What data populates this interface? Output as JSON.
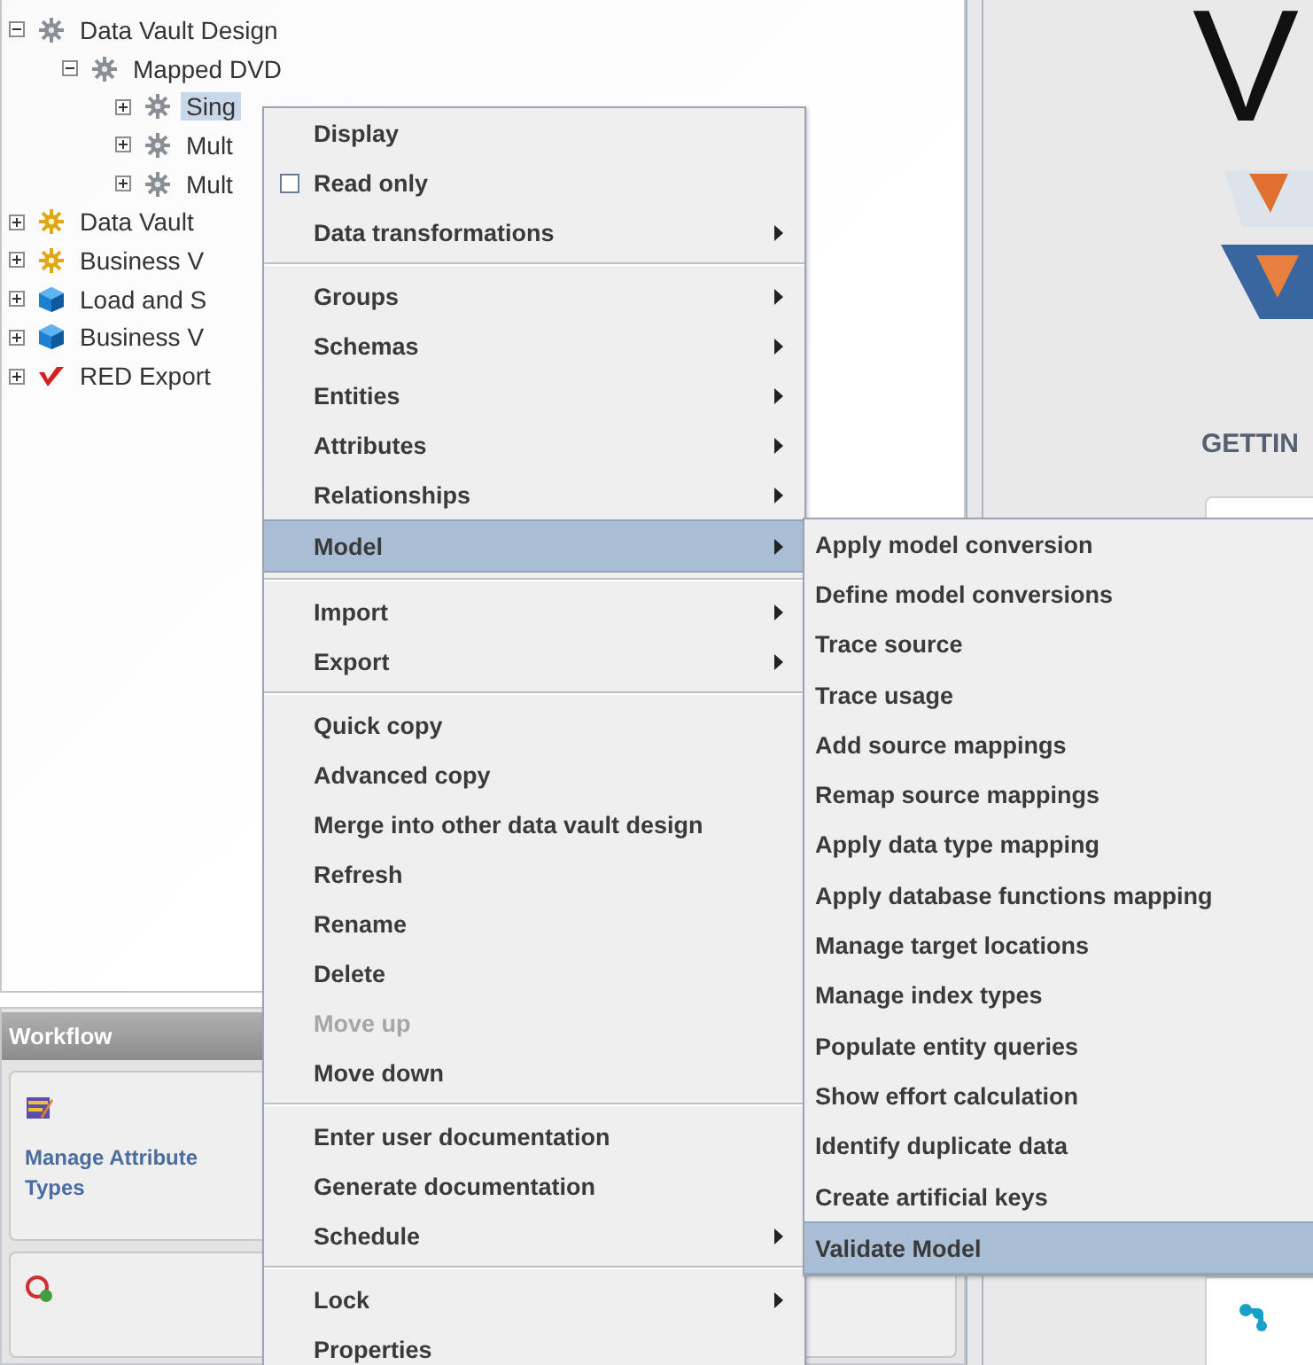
{
  "tree": [
    {
      "label": "Data Vault Design",
      "kind": "design",
      "expanded": true,
      "selected": false,
      "children": [
        {
          "label": "Mapped DVD",
          "kind": "design",
          "expanded": true,
          "selected": false,
          "children": [
            {
              "label": "Sing",
              "kind": "design",
              "expanded": false,
              "selected": true
            },
            {
              "label": "Mult",
              "kind": "design",
              "expanded": false,
              "selected": false
            },
            {
              "label": "Mult",
              "kind": "design",
              "expanded": false,
              "selected": false
            }
          ]
        }
      ]
    },
    {
      "label": "Data Vault",
      "kind": "vault",
      "expanded": false,
      "selected": false
    },
    {
      "label": "Business V",
      "kind": "vault",
      "expanded": false,
      "selected": false
    },
    {
      "label": "Load and S",
      "kind": "cube",
      "expanded": false,
      "selected": false
    },
    {
      "label": "Business V",
      "kind": "cube",
      "expanded": false,
      "selected": false
    },
    {
      "label": "RED Export",
      "kind": "export",
      "expanded": false,
      "selected": false
    }
  ],
  "workflow": {
    "title": "Workflow",
    "tasks": [
      {
        "label": "Manage Attribute Types",
        "kind": "edit"
      },
      {
        "kind": "add"
      }
    ]
  },
  "welcome": {
    "heading": "V",
    "getting_started": "GETTIN"
  },
  "context_menu": {
    "items": [
      {
        "kind": "item",
        "label": "Display",
        "selected": false,
        "disabled": false
      },
      {
        "kind": "check",
        "label": "Read only",
        "checked": false,
        "selected": false,
        "disabled": false
      },
      {
        "kind": "submenu",
        "label": "Data transformations",
        "selected": false,
        "disabled": false
      },
      {
        "kind": "separator"
      },
      {
        "kind": "submenu",
        "label": "Groups",
        "selected": false,
        "disabled": false
      },
      {
        "kind": "submenu",
        "label": "Schemas",
        "selected": false,
        "disabled": false
      },
      {
        "kind": "submenu",
        "label": "Entities",
        "selected": false,
        "disabled": false
      },
      {
        "kind": "submenu",
        "label": "Attributes",
        "selected": false,
        "disabled": false
      },
      {
        "kind": "submenu",
        "label": "Relationships",
        "selected": false,
        "disabled": false
      },
      {
        "kind": "submenu",
        "label": "Model",
        "selected": true,
        "disabled": false
      },
      {
        "kind": "separator"
      },
      {
        "kind": "submenu",
        "label": "Import",
        "selected": false,
        "disabled": false
      },
      {
        "kind": "submenu",
        "label": "Export",
        "selected": false,
        "disabled": false
      },
      {
        "kind": "separator"
      },
      {
        "kind": "item",
        "label": "Quick copy",
        "selected": false,
        "disabled": false
      },
      {
        "kind": "item",
        "label": "Advanced copy",
        "selected": false,
        "disabled": false
      },
      {
        "kind": "item",
        "label": "Merge into other data vault design",
        "selected": false,
        "disabled": false
      },
      {
        "kind": "item",
        "label": "Refresh",
        "selected": false,
        "disabled": false
      },
      {
        "kind": "item",
        "label": "Rename",
        "selected": false,
        "disabled": false
      },
      {
        "kind": "item",
        "label": "Delete",
        "selected": false,
        "disabled": false
      },
      {
        "kind": "item",
        "label": "Move up",
        "selected": false,
        "disabled": true
      },
      {
        "kind": "item",
        "label": "Move down",
        "selected": false,
        "disabled": false
      },
      {
        "kind": "separator"
      },
      {
        "kind": "item",
        "label": "Enter user documentation",
        "selected": false,
        "disabled": false
      },
      {
        "kind": "item",
        "label": "Generate documentation",
        "selected": false,
        "disabled": false
      },
      {
        "kind": "submenu",
        "label": "Schedule",
        "selected": false,
        "disabled": false
      },
      {
        "kind": "separator"
      },
      {
        "kind": "submenu",
        "label": "Lock",
        "selected": false,
        "disabled": false
      },
      {
        "kind": "item",
        "label": "Properties",
        "selected": false,
        "disabled": false
      }
    ]
  },
  "model_submenu": {
    "items": [
      {
        "kind": "item",
        "label": "Apply model conversion",
        "selected": false,
        "disabled": false
      },
      {
        "kind": "item",
        "label": "Define model conversions",
        "selected": false,
        "disabled": false
      },
      {
        "kind": "item",
        "label": "Trace source",
        "selected": false,
        "disabled": false
      },
      {
        "kind": "item",
        "label": "Trace usage",
        "selected": false,
        "disabled": false
      },
      {
        "kind": "item",
        "label": "Add source mappings",
        "selected": false,
        "disabled": false
      },
      {
        "kind": "item",
        "label": "Remap source mappings",
        "selected": false,
        "disabled": false
      },
      {
        "kind": "item",
        "label": "Apply data type mapping",
        "selected": false,
        "disabled": false
      },
      {
        "kind": "item",
        "label": "Apply database functions mapping",
        "selected": false,
        "disabled": false
      },
      {
        "kind": "item",
        "label": "Manage target locations",
        "selected": false,
        "disabled": false
      },
      {
        "kind": "item",
        "label": "Manage index types",
        "selected": false,
        "disabled": false
      },
      {
        "kind": "item",
        "label": "Populate entity queries",
        "selected": false,
        "disabled": false
      },
      {
        "kind": "item",
        "label": "Show effort calculation",
        "selected": false,
        "disabled": false
      },
      {
        "kind": "item",
        "label": "Identify duplicate data",
        "selected": false,
        "disabled": false
      },
      {
        "kind": "item",
        "label": "Create artificial keys",
        "selected": false,
        "disabled": false
      },
      {
        "kind": "item",
        "label": "Validate Model",
        "selected": true,
        "disabled": false
      }
    ]
  }
}
